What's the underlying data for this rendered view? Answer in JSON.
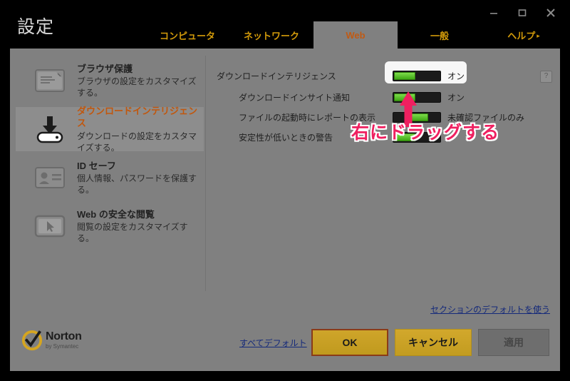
{
  "window": {
    "title": "設定",
    "controls": [
      {
        "name": "minimize",
        "glyph": "─"
      },
      {
        "name": "maximize",
        "glyph": "□"
      },
      {
        "name": "close",
        "glyph": "✕"
      }
    ]
  },
  "tabs": [
    {
      "label": "コンピュータ",
      "active": false
    },
    {
      "label": "ネットワーク",
      "active": false
    },
    {
      "label": "Web",
      "active": true
    },
    {
      "label": "一般",
      "active": false
    },
    {
      "label": "ヘルプ",
      "active": false,
      "chevron": "▸"
    }
  ],
  "sidebar": {
    "items": [
      {
        "icon": "browser-window-icon",
        "title": "ブラウザ保護",
        "desc": "ブラウザの設定をカスタマイズする。",
        "selected": false
      },
      {
        "icon": "download-icon",
        "title": "ダウンロードインテリジェンス",
        "desc": "ダウンロードの設定をカスタマイズする。",
        "selected": true
      },
      {
        "icon": "id-card-icon",
        "title": "ID セーフ",
        "desc": "個人情報、パスワードを保護する。",
        "selected": false
      },
      {
        "icon": "cursor-window-icon",
        "title": "Web の安全な閲覧",
        "desc": "閲覧の設定をカスタマイズする。",
        "selected": false
      }
    ]
  },
  "settings": {
    "rows": [
      {
        "label": "ダウンロードインテリジェンス",
        "indent": false,
        "toggle_position": "left",
        "value": "オン",
        "highlighted": true,
        "help": "?"
      },
      {
        "label": "ダウンロードインサイト通知",
        "indent": true,
        "toggle_position": "left",
        "value": "オン",
        "highlighted": false
      },
      {
        "label": "ファイルの起動時にレポートの表示",
        "indent": true,
        "toggle_position": "mid",
        "value": "未確認ファイルのみ",
        "highlighted": false
      },
      {
        "label": "安定性が低いときの警告",
        "indent": true,
        "toggle_position": "left",
        "value": "",
        "highlighted": false
      }
    ]
  },
  "annotation": {
    "text": "右にドラッグする",
    "arrow": "up-arrow",
    "color": "#ef2060"
  },
  "links": {
    "section_default": "セクションのデフォルトを使う",
    "all_default": "すべてデフォルト"
  },
  "footer": {
    "logo_name": "Norton",
    "logo_sub": "by Symantec",
    "buttons": [
      {
        "label": "OK",
        "style": "ok",
        "enabled": true
      },
      {
        "label": "キャンセル",
        "style": "cancel",
        "enabled": true
      },
      {
        "label": "適用",
        "style": "apply",
        "enabled": false
      }
    ]
  },
  "colors": {
    "accent_orange": "#c1570d",
    "tab_gold": "#d39b0a",
    "panel_gray": "#808080",
    "annotation_pink": "#ef2060",
    "link_blue": "#14297a",
    "toggle_green": "#3ea814"
  }
}
